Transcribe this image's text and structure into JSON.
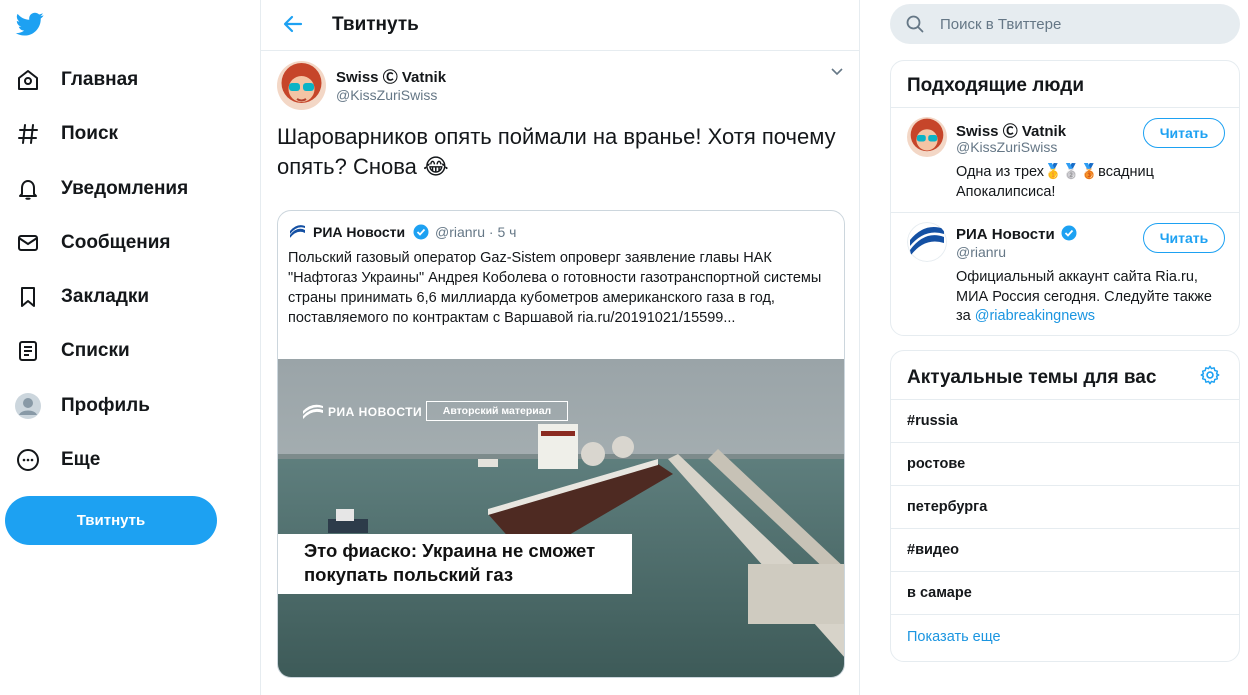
{
  "nav": {
    "items": [
      {
        "label": "Главная",
        "icon": "home-icon"
      },
      {
        "label": "Поиск",
        "icon": "hashtag-icon"
      },
      {
        "label": "Уведомления",
        "icon": "bell-icon"
      },
      {
        "label": "Сообщения",
        "icon": "mail-icon"
      },
      {
        "label": "Закладки",
        "icon": "bookmark-icon"
      },
      {
        "label": "Списки",
        "icon": "list-icon"
      },
      {
        "label": "Профиль",
        "icon": "profile-icon"
      },
      {
        "label": "Еще",
        "icon": "more-icon"
      }
    ],
    "tweet_button": "Твитнуть"
  },
  "main": {
    "title": "Твитнуть",
    "tweet": {
      "author_name": "Swiss Ⓒ Vatnik",
      "author_handle": "@KissZuriSwiss",
      "text": "Шароварников опять поймали на вранье! Хотя почему опять? Снова 😂",
      "quote": {
        "name": "РИА Новости",
        "handle_time": "@rianru · 5 ч",
        "text": "Польский газовый оператор Gaz-Sistem опроверг заявление главы НАК \"Нафтогаз Украины\" Андрея Коболева о готовности газотранспортной системы страны принимать 6,6 миллиарда кубометров американского газа в год, поставляемого по контрактам с Варшавой ria.ru/20191021/15599...",
        "image": {
          "logo_text": "РИА НОВОСТИ",
          "tag": "Авторский материал",
          "headline_1": "Это фиаско: Украина не сможет",
          "headline_2": "покупать польский газ"
        }
      }
    }
  },
  "search": {
    "placeholder": "Поиск в Твиттере"
  },
  "who_to_follow": {
    "title": "Подходящие люди",
    "people": [
      {
        "name": "Swiss Ⓒ Vatnik",
        "handle": "@KissZuriSwiss",
        "bio_1": "Одна из трех🥇🥈🥉всадниц",
        "bio_2": "Апокалипсиса!",
        "button": "Читать"
      },
      {
        "name": "РИА Новости",
        "handle": "@rianru",
        "bio_1": "Официальный аккаунт сайта Ria.ru,",
        "bio_2": "МИА Россия сегодня. Следуйте также",
        "bio_3_prefix": "за ",
        "bio_3_link": "@riabreakingnews",
        "button": "Читать"
      }
    ]
  },
  "trends": {
    "title": "Актуальные темы для вас",
    "items": [
      "#russia",
      "ростове",
      "петербурга",
      "#видео",
      "в самаре"
    ],
    "show_more": "Показать еще"
  },
  "colors": {
    "accent": "#1da1f2",
    "text": "#14171a",
    "secondary": "#657786",
    "border": "#e6ecf0"
  }
}
